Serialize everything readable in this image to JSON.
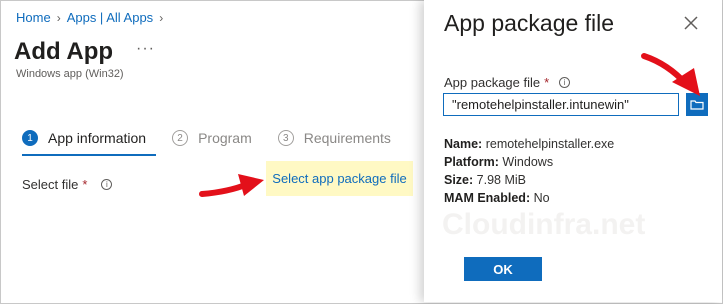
{
  "breadcrumb": {
    "items": [
      "Home",
      "Apps | All Apps"
    ]
  },
  "page": {
    "title": "Add App",
    "more": "···",
    "subtitle": "Windows app (Win32)"
  },
  "steps": [
    {
      "number": "1",
      "label": "App information"
    },
    {
      "number": "2",
      "label": "Program"
    },
    {
      "number": "3",
      "label": "Requirements"
    }
  ],
  "form": {
    "select_file_label": "Select file",
    "required_mark": "*",
    "select_link": "Select app package file"
  },
  "panel": {
    "title": "App package file",
    "field_label": "App package file",
    "required_mark": "*",
    "file_value": "\"remotehelpinstaller.intunewin\"",
    "details": {
      "name_label": "Name:",
      "name_value": "remotehelpinstaller.exe",
      "platform_label": "Platform:",
      "platform_value": "Windows",
      "size_label": "Size:",
      "size_value": "7.98 MiB",
      "mam_label": "MAM Enabled:",
      "mam_value": "No"
    },
    "ok_label": "OK"
  },
  "watermark": "Cloudinfra.net",
  "colors": {
    "accent": "#0f6cbd",
    "highlight": "#fff9c4",
    "arrow": "#e3101a"
  },
  "icons": {
    "close": "close-icon",
    "browse": "folder-icon",
    "info": "info-icon",
    "chevron": "chevron-right-icon"
  }
}
